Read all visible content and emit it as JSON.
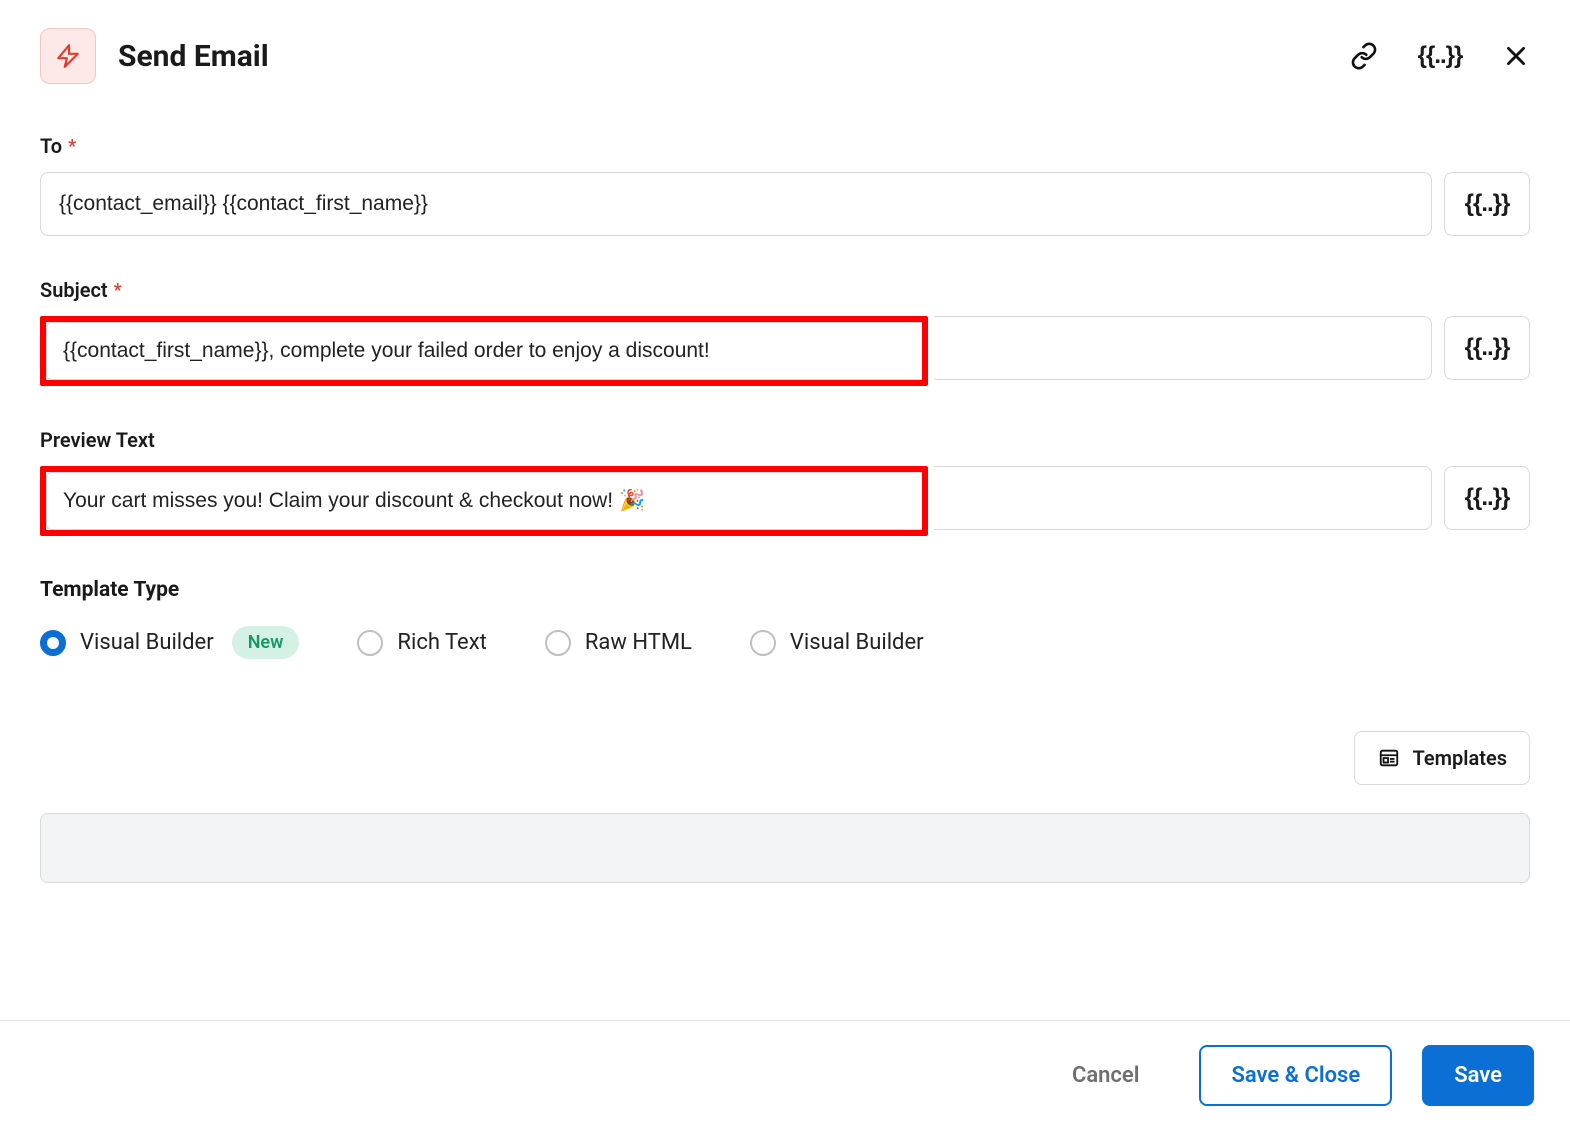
{
  "header": {
    "title": "Send Email"
  },
  "fields": {
    "to": {
      "label": "To",
      "required": true,
      "value": "{{contact_email}} {{contact_first_name}}"
    },
    "subject": {
      "label": "Subject",
      "required": true,
      "value": "{{contact_first_name}}, complete your failed order to enjoy a discount!"
    },
    "preview": {
      "label": "Preview Text",
      "required": false,
      "value": "Your cart misses you! Claim your discount & checkout now! 🎉"
    }
  },
  "template_type": {
    "label": "Template Type",
    "options": [
      {
        "label": "Visual Builder",
        "selected": true,
        "badge": "New"
      },
      {
        "label": "Rich Text",
        "selected": false
      },
      {
        "label": "Raw HTML",
        "selected": false
      },
      {
        "label": "Visual Builder",
        "selected": false
      }
    ]
  },
  "buttons": {
    "templates": "Templates",
    "cancel": "Cancel",
    "save_close": "Save & Close",
    "save": "Save"
  },
  "token_glyph": "{{..}}"
}
